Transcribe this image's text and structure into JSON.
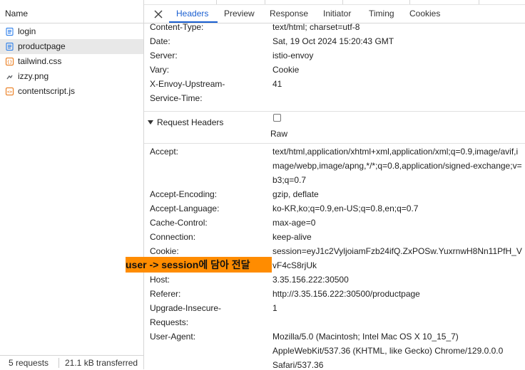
{
  "request_list": {
    "column_header": "Name",
    "items": [
      {
        "label": "login",
        "icon": "document-icon",
        "color": "#1a73e8"
      },
      {
        "label": "productpage",
        "icon": "document-icon",
        "color": "#1a73e8",
        "selected": true
      },
      {
        "label": "tailwind.css",
        "icon": "stylesheet-icon",
        "color": "#e8710a"
      },
      {
        "label": "izzy.png",
        "icon": "image-icon",
        "color": "#5f6368"
      },
      {
        "label": "contentscript.js",
        "icon": "script-icon",
        "color": "#e8710a"
      }
    ],
    "footer": {
      "requests": "5 requests",
      "transferred": "21.1 kB transferred"
    }
  },
  "tabs": [
    "Headers",
    "Preview",
    "Response",
    "Initiator",
    "Timing",
    "Cookies"
  ],
  "response_headers": [
    {
      "name": "Content-Type:",
      "value": "text/html; charset=utf-8"
    },
    {
      "name": "Date:",
      "value": "Sat, 19 Oct 2024 15:20:43 GMT"
    },
    {
      "name": "Server:",
      "value": "istio-envoy"
    },
    {
      "name": "Vary:",
      "value": "Cookie"
    },
    {
      "name": "X-Envoy-Upstream-\nService-Time:",
      "value": "41"
    }
  ],
  "request_section": {
    "title": "Request Headers",
    "raw_label": "Raw"
  },
  "request_headers": [
    {
      "name": "Accept:",
      "value": "text/html,application/xhtml+xml,application/xml;q=0.9,image/avif,image/webp,image/apng,*/*;q=0.8,application/signed-exchange;v=b3;q=0.7"
    },
    {
      "name": "Accept-Encoding:",
      "value": "gzip, deflate"
    },
    {
      "name": "Accept-Language:",
      "value": "ko-KR,ko;q=0.9,en-US;q=0.8,en;q=0.7"
    },
    {
      "name": "Cache-Control:",
      "value": "max-age=0"
    },
    {
      "name": "Connection:",
      "value": "keep-alive"
    },
    {
      "name": "Cookie:",
      "value": "session=eyJ1c2VyljoiamFzb24ifQ.ZxPOSw.YuxrnwH8Nn11PfH_VvF4cS8rjUk"
    },
    {
      "name": "Host:",
      "value": "3.35.156.222:30500"
    },
    {
      "name": "Referer:",
      "value": "http://3.35.156.222:30500/productpage"
    },
    {
      "name": "Upgrade-Insecure-\nRequests:",
      "value": "1"
    },
    {
      "name": "User-Agent:",
      "value": "Mozilla/5.0 (Macintosh; Intel Mac OS X 10_15_7) AppleWebKit/537.36 (KHTML, like Gecko) Chrome/129.0.0.0 Safari/537.36"
    }
  ],
  "annotation": "user -> session에 담아 전달",
  "colors": {
    "accent": "#1a5fd1",
    "annotation_bg": "#ff8c00",
    "selected_row": "#e8e8e8"
  }
}
